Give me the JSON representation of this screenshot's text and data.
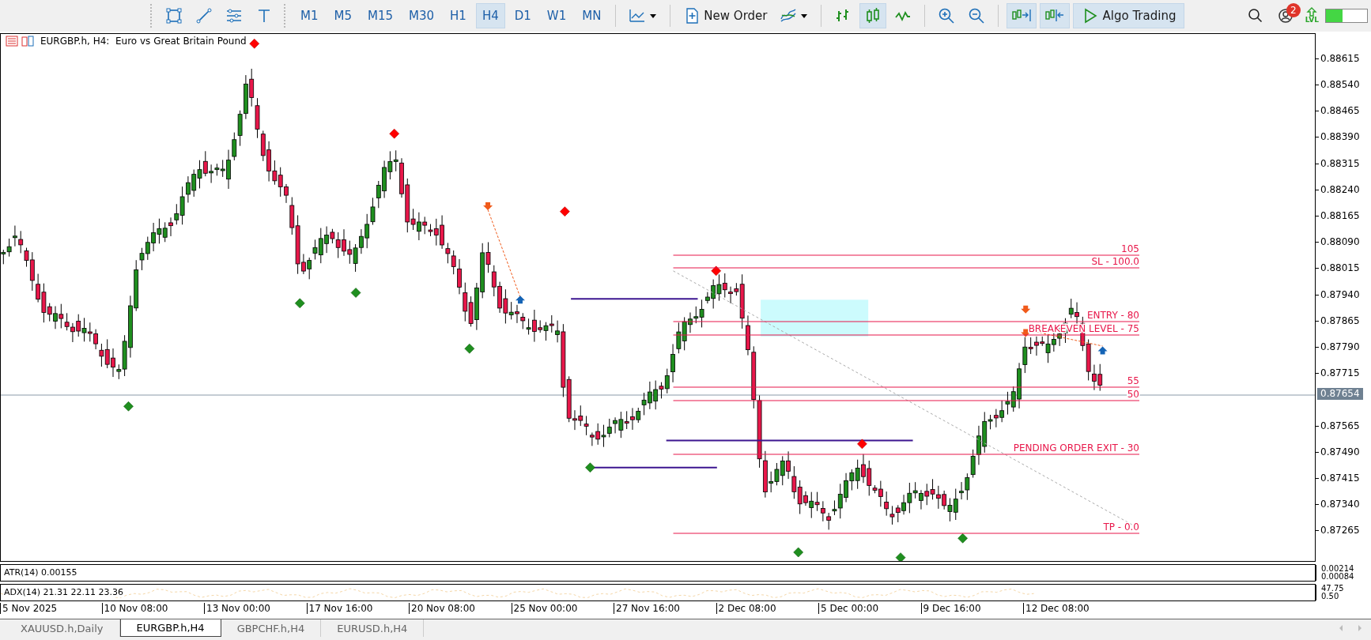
{
  "toolbar": {
    "timeframes": [
      {
        "label": "M1",
        "selected": false
      },
      {
        "label": "M5",
        "selected": false
      },
      {
        "label": "M15",
        "selected": false
      },
      {
        "label": "M30",
        "selected": false
      },
      {
        "label": "H1",
        "selected": false
      },
      {
        "label": "H4",
        "selected": true
      },
      {
        "label": "D1",
        "selected": false
      },
      {
        "label": "W1",
        "selected": false
      },
      {
        "label": "MN",
        "selected": false
      }
    ],
    "chart_types": [
      {
        "kind": "bars",
        "selected": false
      },
      {
        "kind": "candles",
        "selected": true
      },
      {
        "kind": "line",
        "selected": false
      }
    ],
    "new_order": {
      "label": "New Order"
    },
    "auto_scroll": {
      "on": true
    },
    "chart_shift": {
      "on": true
    },
    "algo_trading": {
      "label": "Algo Trading",
      "on": true
    },
    "notifications": {
      "count": "2"
    },
    "lvl": {
      "label": "LVL"
    },
    "meter": {
      "level": 0.4
    }
  },
  "chart": {
    "title": "EURGBP.h, H4:  Euro vs Great Britain Pound",
    "levels": [
      "105",
      "SL - 100.0",
      "ENTRY - 80",
      "BREAKEVEN LEVEL - 75",
      "55",
      "50",
      "PENDING ORDER EXIT - 30",
      "TP - 0.0"
    ],
    "price_ticks": [
      "0.88615",
      "0.88540",
      "0.88465",
      "0.88390",
      "0.88315",
      "0.88240",
      "0.88165",
      "0.88090",
      "0.88015",
      "0.87940",
      "0.87865",
      "0.87790",
      "0.87715",
      "0.87565",
      "0.87490",
      "0.87415",
      "0.87340",
      "0.87265"
    ],
    "current_price": "0.87654"
  },
  "atr": {
    "label": "ATR(14) 0.00155",
    "ticks": [
      "0.00214",
      "0.00084"
    ]
  },
  "adx": {
    "label": "ADX(14) 21.31 22.11 23.36",
    "ticks": [
      "47.75",
      "0.50"
    ]
  },
  "time_axis": [
    "5 Nov 2025",
    "10 Nov 08:00",
    "13 Nov 00:00",
    "17 Nov 16:00",
    "20 Nov 08:00",
    "25 Nov 00:00",
    "27 Nov 16:00",
    "2 Dec 08:00",
    "5 Dec 00:00",
    "9 Dec 16:00",
    "12 Dec 08:00"
  ],
  "tabs": [
    {
      "label": "XAUUSD.h,Daily",
      "selected": false
    },
    {
      "label": "EURGBP.h,H4",
      "selected": true
    },
    {
      "label": "GBPCHF.h,H4",
      "selected": false
    },
    {
      "label": "EURUSD.h,H4",
      "selected": false
    }
  ]
}
